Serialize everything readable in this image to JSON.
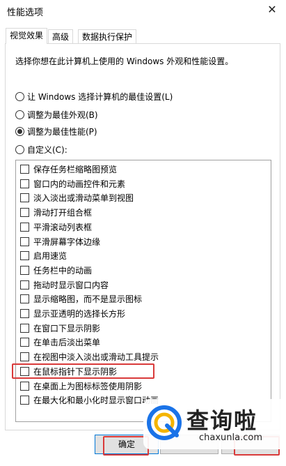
{
  "window": {
    "title": "性能选项",
    "close_glyph": "✕"
  },
  "tabs": [
    {
      "label": "视觉效果",
      "active": true
    },
    {
      "label": "高级",
      "active": false
    },
    {
      "label": "数据执行保护",
      "active": false
    }
  ],
  "description": "选择你想在此计算机上使用的 Windows 外观和性能设置。",
  "radios": [
    {
      "label": "让 Windows 选择计算机的最佳设置(L)",
      "selected": false
    },
    {
      "label": "调整为最佳外观(B)",
      "selected": false
    },
    {
      "label": "调整为最佳性能(P)",
      "selected": true
    },
    {
      "label": "自定义(C):",
      "selected": false
    }
  ],
  "options": [
    {
      "label": "保存任务栏缩略图预览",
      "checked": false
    },
    {
      "label": "窗口内的动画控件和元素",
      "checked": false
    },
    {
      "label": "淡入淡出或滑动菜单到视图",
      "checked": false
    },
    {
      "label": "滑动打开组合框",
      "checked": false
    },
    {
      "label": "平滑滚动列表框",
      "checked": false
    },
    {
      "label": "平滑屏幕字体边缘",
      "checked": false
    },
    {
      "label": "启用速览",
      "checked": false
    },
    {
      "label": "任务栏中的动画",
      "checked": false
    },
    {
      "label": "拖动时显示窗口内容",
      "checked": false
    },
    {
      "label": "显示缩略图，而不是显示图标",
      "checked": false
    },
    {
      "label": "显示亚透明的选择长方形",
      "checked": false
    },
    {
      "label": "在窗口下显示阴影",
      "checked": false
    },
    {
      "label": "在单击后淡出菜单",
      "checked": false
    },
    {
      "label": "在视图中淡入淡出或滑动工具提示",
      "checked": false
    },
    {
      "label": "在鼠标指针下显示阴影",
      "checked": false
    },
    {
      "label": "在桌面上为图标标签使用阴影",
      "checked": false
    },
    {
      "label": "在最大化和最小化时显示窗口动画",
      "checked": false
    }
  ],
  "buttons": {
    "ok": "确定",
    "cancel": "",
    "apply": ""
  },
  "watermark": {
    "cn": "查询啦",
    "en": "chaxunla.com"
  },
  "colors": {
    "highlight": "#d93a3a",
    "focus": "#0078d7",
    "button_bg": "#e1e1e1"
  }
}
